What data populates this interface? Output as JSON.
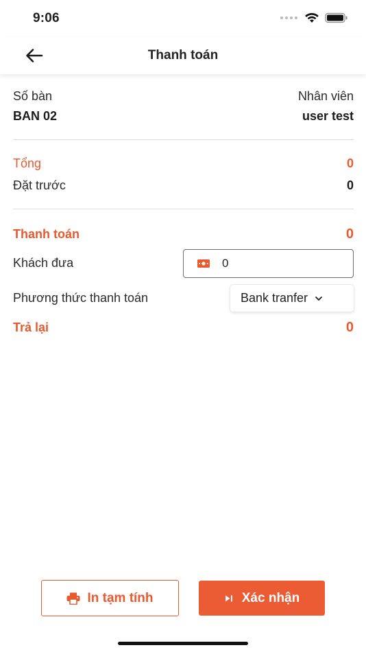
{
  "status_bar": {
    "time": "9:06"
  },
  "nav": {
    "title": "Thanh toán"
  },
  "table": {
    "label": "Số bàn",
    "value": "BAN 02"
  },
  "staff": {
    "label": "Nhân viên",
    "value": "user test"
  },
  "total": {
    "label": "Tổng",
    "value": "0"
  },
  "deposit": {
    "label": "Đặt trước",
    "value": "0"
  },
  "payment": {
    "label": "Thanh toán",
    "value": "0"
  },
  "cash_given": {
    "label": "Khách đưa",
    "value": "0"
  },
  "payment_method": {
    "label": "Phương thức thanh toán",
    "selected": "Bank tranfer"
  },
  "change": {
    "label": "Trả lại",
    "value": "0"
  },
  "actions": {
    "print_label": "In tạm tính",
    "confirm_label": "Xác nhận"
  },
  "colors": {
    "accent": "#e85a2e",
    "accent_button": "#ec5c34"
  },
  "icons": [
    "back-arrow-icon",
    "cellular-dots-icon",
    "wifi-icon",
    "battery-icon",
    "money-icon",
    "chevron-down-icon",
    "printer-icon",
    "play-next-icon"
  ]
}
